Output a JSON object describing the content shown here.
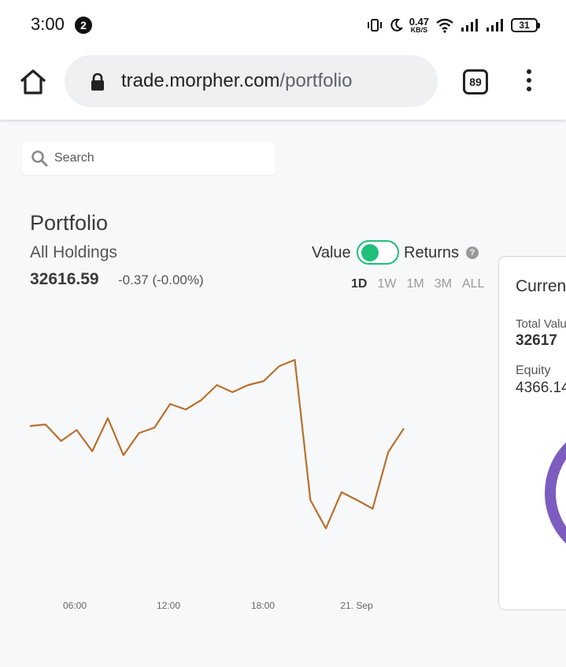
{
  "status_bar": {
    "time": "3:00",
    "notification_count": "2",
    "net_speed_value": "0.47",
    "net_speed_unit": "KB/S",
    "battery": "31"
  },
  "browser": {
    "url_domain": "trade.morpher.com",
    "url_path": "/portfolio",
    "tab_count": "89"
  },
  "search": {
    "placeholder": "Search"
  },
  "portfolio": {
    "title": "Portfolio",
    "subtitle": "All Holdings",
    "value": "32616.59",
    "change": "-0.37 (-0.00%)",
    "toggle_left_label": "Value",
    "toggle_right_label": "Returns",
    "toggle_state": "Value",
    "help_glyph": "?",
    "ranges": [
      "1D",
      "1W",
      "1M",
      "3M",
      "ALL"
    ],
    "active_range": "1D"
  },
  "chart_data": {
    "type": "line",
    "x_tick_labels": [
      "06:00",
      "12:00",
      "18:00",
      "21. Sep"
    ],
    "series": [
      {
        "color": "#b8702a",
        "values": [
          541,
          539,
          560,
          546,
          573,
          531,
          578,
          550,
          543,
          513,
          520,
          508,
          489,
          498,
          489,
          484,
          465,
          457,
          635,
          671,
          625,
          635,
          646,
          574,
          544
        ]
      }
    ],
    "y_axis_shown": false,
    "grid": false
  },
  "side_panel": {
    "title": "Curren",
    "total_label": "Total Valu",
    "total_value": "32617",
    "equity_label": "Equity",
    "equity_value": "4366.14",
    "donut_color": "#7c5cbf"
  },
  "colors": {
    "accent_green": "#1fc07a",
    "line_color": "#b8702a",
    "donut_purple": "#7c5cbf"
  }
}
